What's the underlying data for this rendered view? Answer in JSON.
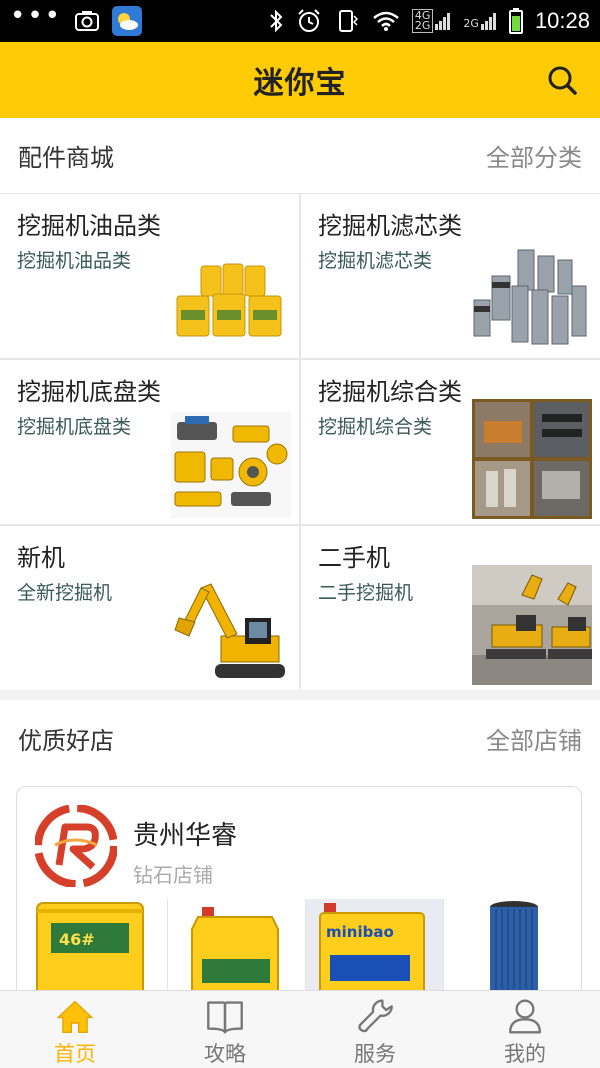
{
  "status_bar": {
    "time": "10:28",
    "network_top": "4G",
    "network_bottom": "2G",
    "network2": "2G"
  },
  "header": {
    "title": "迷你宝"
  },
  "parts_section": {
    "title": "配件商城",
    "link": "全部分类"
  },
  "categories": [
    {
      "title": "挖掘机油品类",
      "subtitle": "挖掘机油品类"
    },
    {
      "title": "挖掘机滤芯类",
      "subtitle": "挖掘机滤芯类"
    },
    {
      "title": "挖掘机底盘类",
      "subtitle": "挖掘机底盘类"
    },
    {
      "title": "挖掘机综合类",
      "subtitle": "挖掘机综合类"
    },
    {
      "title": "新机",
      "subtitle": "全新挖掘机"
    },
    {
      "title": "二手机",
      "subtitle": "二手挖掘机"
    }
  ],
  "shops_section": {
    "title": "优质好店",
    "link": "全部店铺"
  },
  "shop": {
    "name": "贵州华睿",
    "level": "钻石店铺",
    "product_brand": "minibao",
    "product_label": "46#"
  },
  "tabs": [
    {
      "label": "首页",
      "icon": "home-icon",
      "active": true
    },
    {
      "label": "攻略",
      "icon": "book-icon",
      "active": false
    },
    {
      "label": "服务",
      "icon": "wrench-icon",
      "active": false
    },
    {
      "label": "我的",
      "icon": "user-icon",
      "active": false
    }
  ],
  "colors": {
    "brand_yellow": "#ffcb05",
    "active_tab": "#ffb400",
    "subtitle": "#3a5a55"
  }
}
